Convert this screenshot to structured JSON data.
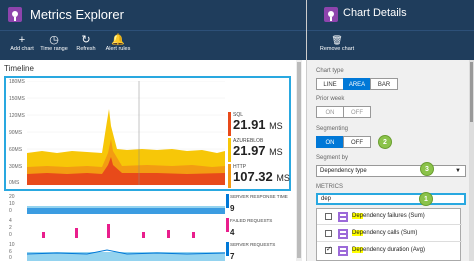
{
  "left": {
    "title": "Metrics Explorer",
    "commands": [
      {
        "icon": "plus-icon",
        "glyph": "+",
        "label": "Add chart"
      },
      {
        "icon": "clock-icon",
        "glyph": "◷",
        "label": "Time range"
      },
      {
        "icon": "refresh-icon",
        "glyph": "↻",
        "label": "Refresh"
      },
      {
        "icon": "bell-icon",
        "glyph": "🔔",
        "label": "Alert rules"
      }
    ],
    "timeline_label": "Timeline",
    "y_ticks": [
      "180MS",
      "150MS",
      "120MS",
      "90MS",
      "60MS",
      "30MS",
      "0MS"
    ],
    "metrics": [
      {
        "name": "SQL",
        "value": "21.91",
        "unit": "MS",
        "color": "#e84a1a"
      },
      {
        "name": "AZUREBLOB",
        "value": "21.97",
        "unit": "MS",
        "color": "#f7c708"
      },
      {
        "name": "HTTP",
        "value": "107.32",
        "unit": "MS",
        "color": "#f39c12"
      }
    ],
    "mini_charts": [
      {
        "label": "SERVER RESPONSE TIME",
        "value": "9"
      },
      {
        "label": "FAILED REQUESTS",
        "value": "4"
      },
      {
        "label": "SERVER REQUESTS",
        "value": "7"
      }
    ],
    "mini_ticks": [
      "20",
      "10",
      "0",
      "4",
      "2",
      "0",
      "10",
      "6",
      "0"
    ]
  },
  "right": {
    "title": "Chart Details",
    "command": {
      "icon": "trash-icon",
      "glyph": "🗑",
      "label": "Remove chart"
    },
    "chart_type_label": "Chart type",
    "chart_types": [
      "LINE",
      "AREA",
      "BAR"
    ],
    "chart_type_selected": "AREA",
    "prior_week_label": "Prior week",
    "prior_week_options": [
      "ON",
      "OFF"
    ],
    "prior_week_selected": "OFF",
    "segmenting_label": "Segmenting",
    "segmenting_options": [
      "ON",
      "OFF"
    ],
    "segmenting_selected": "ON",
    "segment_by_label": "Segment by",
    "segment_by_value": "Dependency type",
    "metrics_label": "METRICS",
    "search_value": "dep",
    "metric_items": [
      {
        "prefix": "Dep",
        "rest": "endency failures (Sum)",
        "checked": false
      },
      {
        "prefix": "Dep",
        "rest": "endency calls (Sum)",
        "checked": false
      },
      {
        "prefix": "Dep",
        "rest": "endency duration (Avg)",
        "checked": true
      }
    ],
    "badges": [
      "1",
      "2",
      "3"
    ]
  },
  "colors": {
    "header": "#1f3d5c",
    "accent": "#0078d7",
    "highlight": "#29a8e0",
    "badge": "#8bc34a"
  }
}
